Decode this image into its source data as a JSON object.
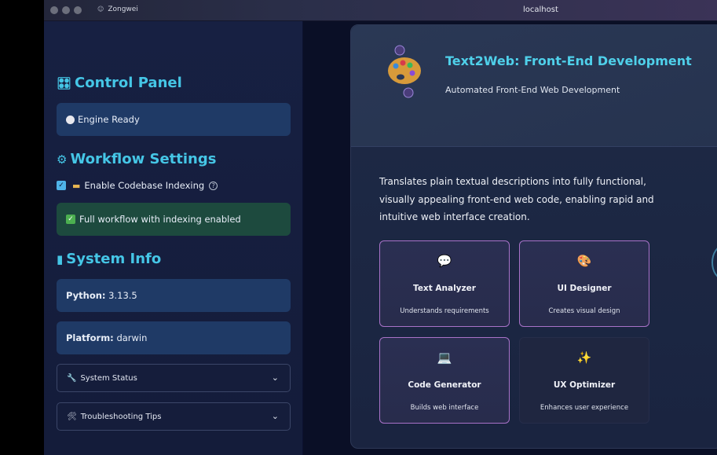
{
  "browser": {
    "tab_title": "Zongwei",
    "url": "localhost"
  },
  "sidebar": {
    "control_panel": {
      "icon": "control-knobs-icon",
      "title": "Control Panel",
      "status": "Engine Ready"
    },
    "workflow": {
      "icon": "gear-icon",
      "title": "Workflow Settings",
      "checkbox_label": "Enable Codebase Indexing",
      "checkbox_checked": true,
      "status": "Full workflow with indexing enabled"
    },
    "system_info": {
      "icon": "bar-chart-icon",
      "title": "System Info",
      "python_label": "Python:",
      "python_value": "3.13.5",
      "platform_label": "Platform:",
      "platform_value": "darwin"
    },
    "expanders": [
      {
        "icon": "wrench-icon",
        "label": "System Status"
      },
      {
        "icon": "tools-icon",
        "label": "Troubleshooting Tips"
      }
    ]
  },
  "main": {
    "hero": {
      "icon": "artist-palette-icon",
      "title": "Text2Web: Front-End Development",
      "subtitle": "Automated Front-End Web Development"
    },
    "description": "Translates plain textual descriptions into fully functional, visually appealing front-end web code, enabling rapid and intuitive web interface creation.",
    "features": [
      {
        "icon": "speech-bubble-icon",
        "title": "Text Analyzer",
        "subtitle": "Understands requirements"
      },
      {
        "icon": "artist-palette-icon",
        "title": "UI Designer",
        "subtitle": "Creates visual design"
      },
      {
        "icon": "laptop-icon",
        "title": "Code Generator",
        "subtitle": "Builds web interface"
      },
      {
        "icon": "sparkles-icon",
        "title": "UX Optimizer",
        "subtitle": "Enhances user experience"
      }
    ]
  },
  "colors": {
    "accent": "#45c6e6",
    "sidebar_bg": "#172042",
    "info_pill": "#1f3a66",
    "success_pill": "#1d4a3e",
    "feature_border": "#a872c8"
  }
}
